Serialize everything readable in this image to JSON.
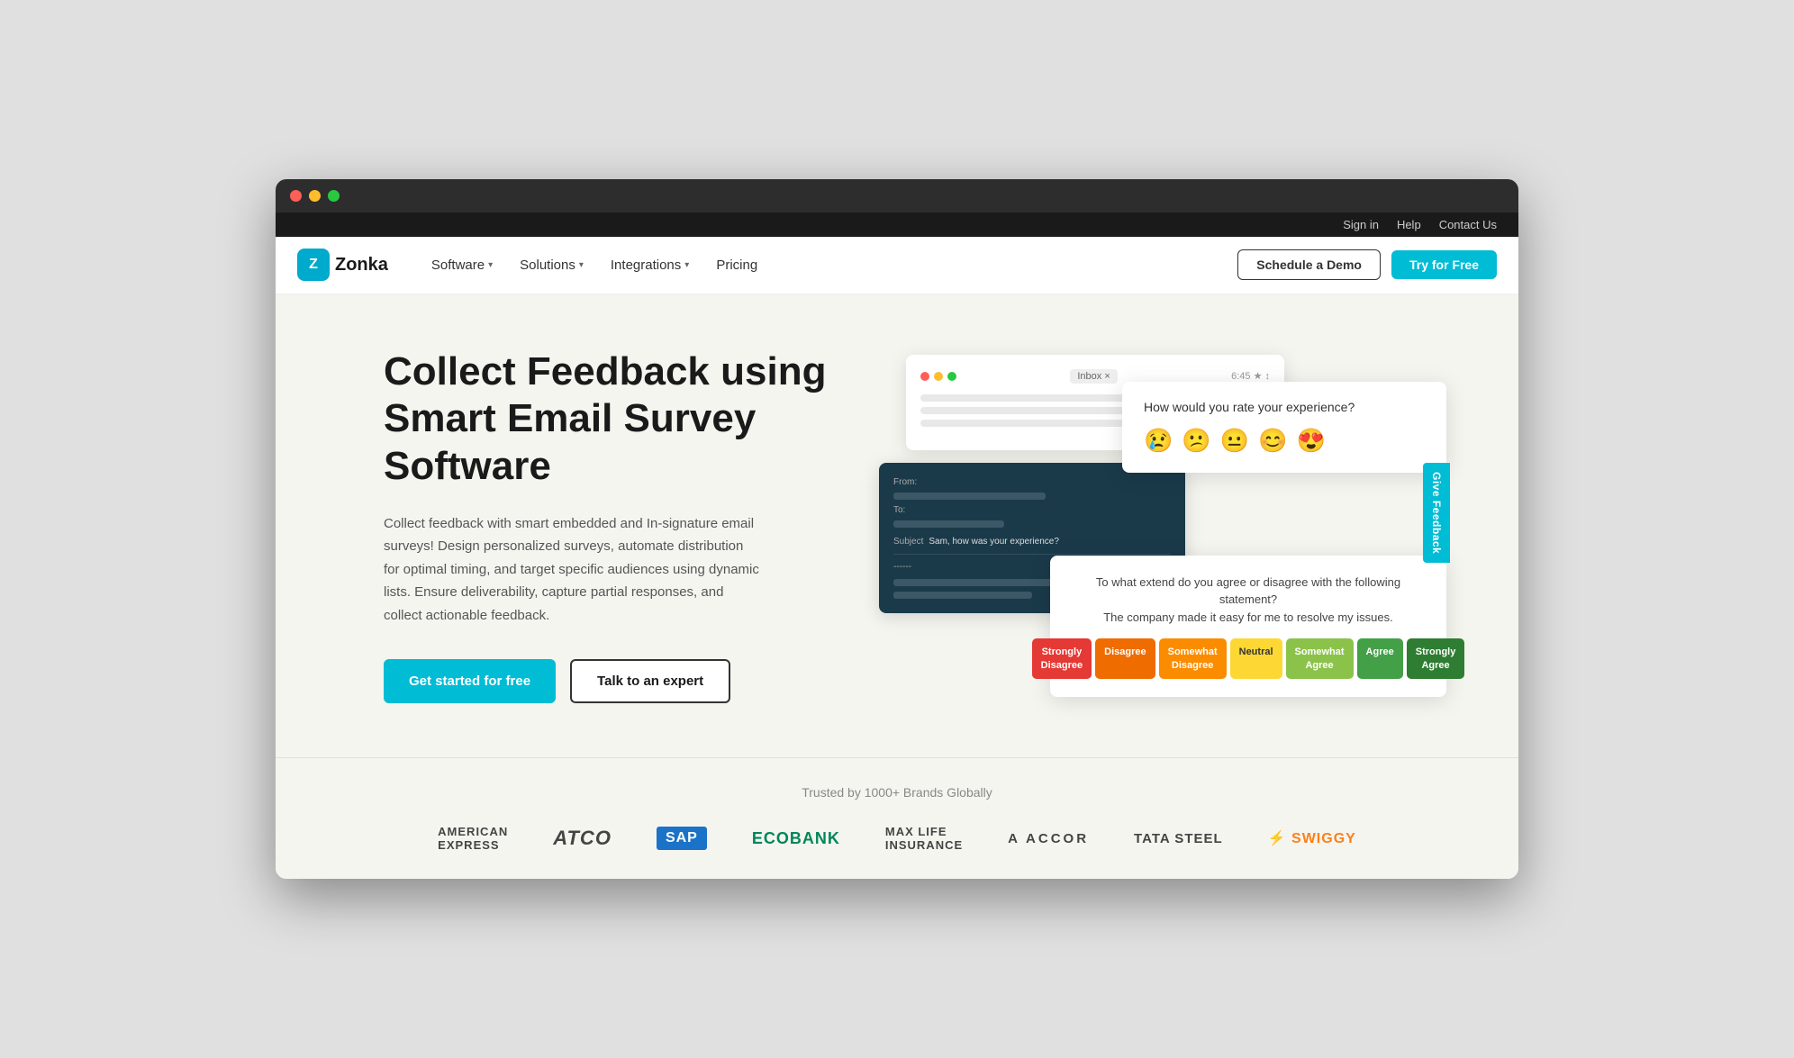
{
  "browser": {
    "traffic_lights": [
      "red",
      "yellow",
      "green"
    ]
  },
  "utility_bar": {
    "links": [
      "Sign in",
      "Help",
      "Contact Us"
    ]
  },
  "nav": {
    "logo_text": "Zonka",
    "logo_letter": "Z",
    "links": [
      {
        "label": "Software",
        "has_dropdown": true
      },
      {
        "label": "Solutions",
        "has_dropdown": true
      },
      {
        "label": "Integrations",
        "has_dropdown": true
      },
      {
        "label": "Pricing",
        "has_dropdown": false
      }
    ],
    "schedule_demo": "Schedule a Demo",
    "try_free": "Try for Free"
  },
  "hero": {
    "title": "Collect Feedback using Smart Email Survey Software",
    "description": "Collect feedback with smart embedded and In-signature email surveys! Design personalized surveys, automate distribution for optimal timing, and target specific audiences using dynamic lists. Ensure deliverability, capture partial responses, and collect actionable feedback.",
    "cta_primary": "Get started for free",
    "cta_secondary": "Talk to an expert"
  },
  "survey_mockup": {
    "email_badge": "Inbox ×",
    "email_time": "6:45 ★ ↕",
    "email_from": "From:",
    "email_to": "To:",
    "email_subject_label": "Subject",
    "email_subject": "Sam, how was your experience?",
    "divider_text": "------",
    "rating_question": "How would you rate your experience?",
    "rating_emojis": [
      "😢",
      "😕",
      "😐",
      "😊",
      "😍"
    ],
    "agreement_question": "To what extend do you agree or disagree with the following statement?",
    "agreement_statement": "The company made it easy for me to resolve my issues.",
    "scale_options": [
      {
        "label": "Strongly Disagree",
        "color_class": "scale-strongly-disagree"
      },
      {
        "label": "Disagree",
        "color_class": "scale-disagree"
      },
      {
        "label": "Somewhat Disagree",
        "color_class": "scale-somewhat-disagree"
      },
      {
        "label": "Neutral",
        "color_class": "scale-neutral"
      },
      {
        "label": "Somewhat Agree",
        "color_class": "scale-somewhat-agree"
      },
      {
        "label": "Agree",
        "color_class": "scale-agree"
      },
      {
        "label": "Strongly Agree",
        "color_class": "scale-strongly-agree"
      }
    ]
  },
  "trusted": {
    "title": "Trusted by 1000+ Brands Globally",
    "brands": [
      {
        "name": "AMERICAN EXPRESS",
        "class": "amex"
      },
      {
        "name": "ATCO",
        "class": ""
      },
      {
        "name": "SAP",
        "class": "sap"
      },
      {
        "name": "Ecobank",
        "class": ""
      },
      {
        "name": "MAX LIFE INSURANCE",
        "class": ""
      },
      {
        "name": "A ACCOR",
        "class": ""
      },
      {
        "name": "TATA STEEL",
        "class": ""
      },
      {
        "name": "⚡ SWIGGY",
        "class": "swiggy"
      }
    ]
  },
  "give_feedback": "Give Feedback"
}
